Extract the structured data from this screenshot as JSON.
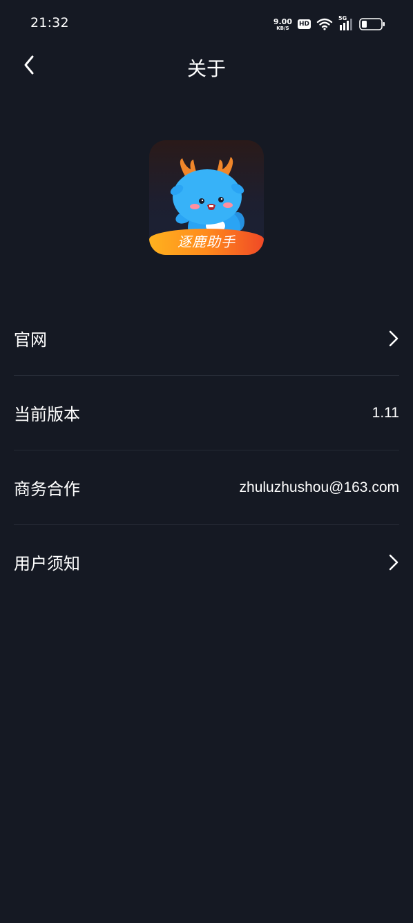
{
  "status_bar": {
    "time": "21:32",
    "net_speed_value": "9.00",
    "net_speed_unit": "KB/S",
    "hd_label": "HD",
    "signal_label": "5G",
    "icons": [
      "wifi-icon",
      "signal-icon",
      "battery-icon"
    ]
  },
  "nav": {
    "title": "关于",
    "back_icon": "chevron-left-icon"
  },
  "logo": {
    "text": "逐鹿助手",
    "colors": {
      "banner_start": "#ffb21f",
      "banner_end": "#f04a26",
      "mascot": "#2aa4f4",
      "horns": "#f0862a"
    }
  },
  "list": {
    "items": [
      {
        "label": "官网",
        "value": "",
        "icon": "chevron-right-icon"
      },
      {
        "label": "当前版本",
        "value": "1.11",
        "icon": ""
      },
      {
        "label": "商务合作",
        "value": "zhuluzhushou@163.com",
        "icon": ""
      },
      {
        "label": "用户须知",
        "value": "",
        "icon": "chevron-right-icon"
      }
    ]
  },
  "colors": {
    "background": "#151923",
    "divider": "#262b36",
    "text": "#ffffff"
  }
}
